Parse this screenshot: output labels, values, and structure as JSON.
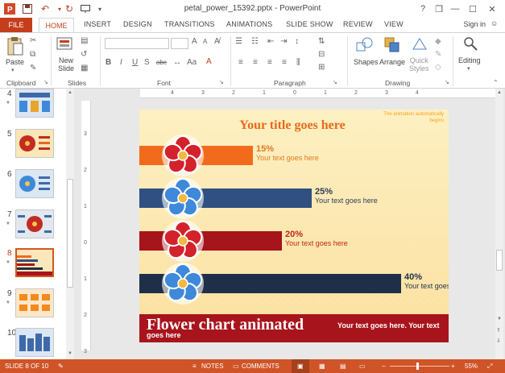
{
  "window": {
    "title": "petal_power_15392.pptx - PowerPoint",
    "help": "?",
    "restore": "❐",
    "minimize": "—",
    "maximize": "☐",
    "close": "✕"
  },
  "tabs": [
    "FILE",
    "HOME",
    "INSERT",
    "DESIGN",
    "TRANSITIONS",
    "ANIMATIONS",
    "SLIDE SHOW",
    "REVIEW",
    "VIEW"
  ],
  "sign_in": "Sign in",
  "ribbon": {
    "clipboard": {
      "label": "Clipboard",
      "paste": "Paste"
    },
    "slides": {
      "label": "Slides",
      "new_slide_line1": "New",
      "new_slide_line2": "Slide"
    },
    "font": {
      "label": "Font",
      "bold": "B",
      "italic": "I",
      "underline": "U",
      "shadow": "S",
      "strike": "abc"
    },
    "paragraph": {
      "label": "Paragraph"
    },
    "drawing": {
      "label": "Drawing",
      "shapes": "Shapes",
      "arrange": "Arrange",
      "quick_styles_line1": "Quick",
      "quick_styles_line2": "Styles"
    },
    "editing": {
      "label": "Editing"
    }
  },
  "thumbnails": [
    {
      "number": "4",
      "star": "*",
      "bg": "#dce6f2"
    },
    {
      "number": "5",
      "star": "",
      "bg": "#f8e7b7"
    },
    {
      "number": "6",
      "star": "",
      "bg": "#dbe7f3"
    },
    {
      "number": "7",
      "star": "*",
      "bg": "#e2e8ee"
    },
    {
      "number": "8",
      "star": "*",
      "bg": "#fbe7bb"
    },
    {
      "number": "9",
      "star": "*",
      "bg": "#fde7c8"
    },
    {
      "number": "10",
      "star": "",
      "bg": "#dbe7f4"
    }
  ],
  "ruler": {
    "h": [
      "4",
      "3",
      "2",
      "1",
      "0",
      "1",
      "2",
      "3",
      "4"
    ],
    "v": [
      "3",
      "2",
      "1",
      "0",
      "1",
      "2",
      "3"
    ]
  },
  "slide": {
    "title": "Your title goes here",
    "note": "The animation automatically begins",
    "rows": [
      {
        "pct": "15%",
        "text": "Your text goes here",
        "bar_color": "#f26b1d",
        "text_color": "#e4791f",
        "flower_petal": "#d3222b",
        "level": 0.15
      },
      {
        "pct": "25%",
        "text": "Your text goes here",
        "bar_color": "#2f5080",
        "text_color": "#2c3e5c",
        "flower_petal": "#3f89db",
        "level": 0.25
      },
      {
        "pct": "20%",
        "text": "Your text goes here",
        "bar_color": "#a6141c",
        "text_color": "#c0261c",
        "flower_petal": "#d3222b",
        "level": 0.2
      },
      {
        "pct": "40%",
        "text": "Your text goes here",
        "bar_color": "#1f2f47",
        "text_color": "#1f2f47",
        "flower_petal": "#3f89db",
        "level": 0.4
      }
    ],
    "heading": "Flower chart animated",
    "footer": "Your text goes here. Your text goes here"
  },
  "status": {
    "slide": "SLIDE 8 OF 10",
    "notes": "NOTES",
    "comments": "COMMENTS",
    "zoom": "55%",
    "minus": "−",
    "plus": "+"
  },
  "colors": {
    "accent": "#c43e1c",
    "status_bar": "#cf5427"
  }
}
